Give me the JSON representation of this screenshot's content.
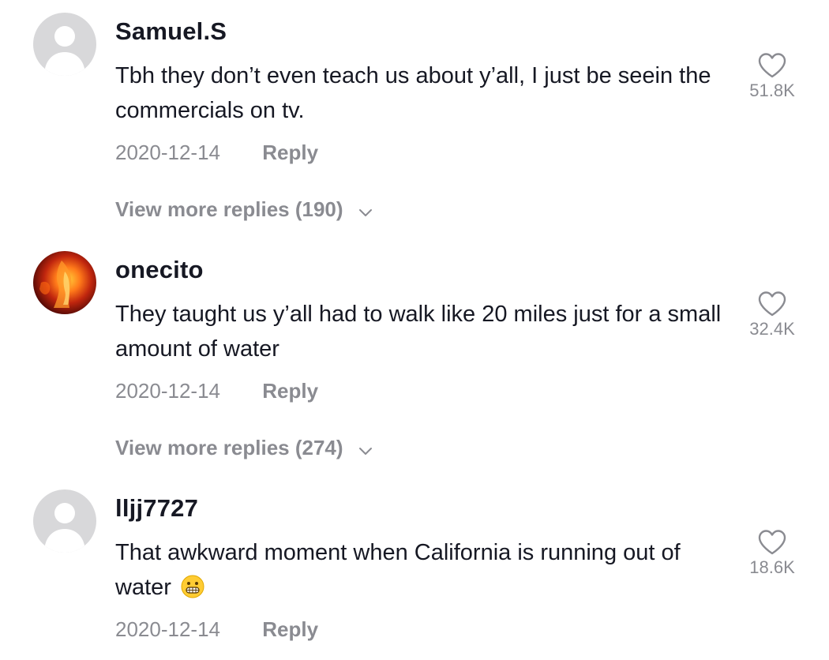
{
  "comments": [
    {
      "username": "Samuel.S",
      "text": "Tbh they don’t even teach us about y’all, I just be seein the commercials on tv.",
      "date": "2020-12-14",
      "reply_label": "Reply",
      "likes": "51.8K",
      "view_more": "View more replies (190)"
    },
    {
      "username": "onecito",
      "text": "They taught us y’all had to walk like 20 miles just for a small amount of water",
      "date": "2020-12-14",
      "reply_label": "Reply",
      "likes": "32.4K",
      "view_more": "View more replies (274)"
    },
    {
      "username": "lljj7727",
      "text": "That awkward moment when California is running out of water",
      "emoji": "grimacing-face-emoji",
      "date": "2020-12-14",
      "reply_label": "Reply",
      "likes": "18.6K"
    }
  ],
  "icons": {
    "like": "heart-outline-icon",
    "expand": "chevron-down-icon",
    "avatar_default": "default-avatar-icon"
  },
  "colors": {
    "text": "#161823",
    "secondary": "#8a8b91",
    "avatar_bg": "#d8d8da"
  }
}
